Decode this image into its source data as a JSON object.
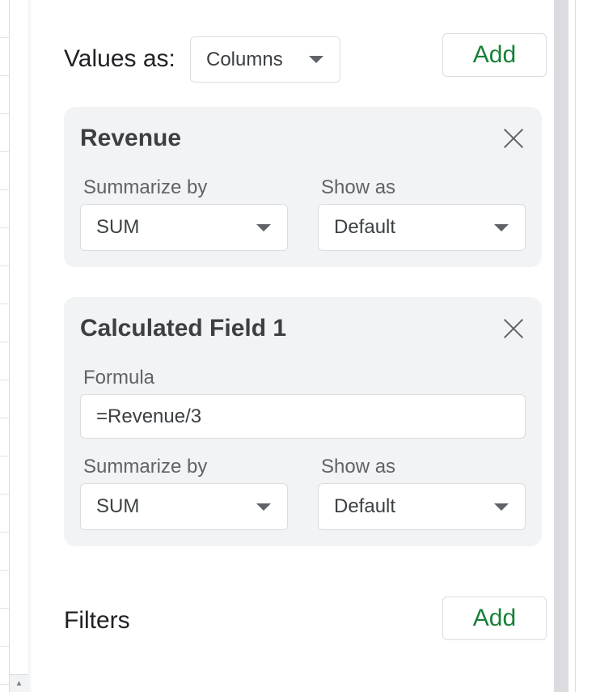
{
  "values": {
    "label": "Values as:",
    "select_value": "Columns",
    "add_label": "Add"
  },
  "cards": [
    {
      "title": "Revenue",
      "summarize_label": "Summarize by",
      "summarize_value": "SUM",
      "show_as_label": "Show as",
      "show_as_value": "Default"
    },
    {
      "title": "Calculated Field 1",
      "formula_label": "Formula",
      "formula_value": "=Revenue/3",
      "summarize_label": "Summarize by",
      "summarize_value": "SUM",
      "show_as_label": "Show as",
      "show_as_value": "Default"
    }
  ],
  "filters": {
    "label": "Filters",
    "add_label": "Add"
  },
  "colors": {
    "accent_green": "#188038",
    "card_bg": "#f1f3f4",
    "border": "#dadce0"
  }
}
